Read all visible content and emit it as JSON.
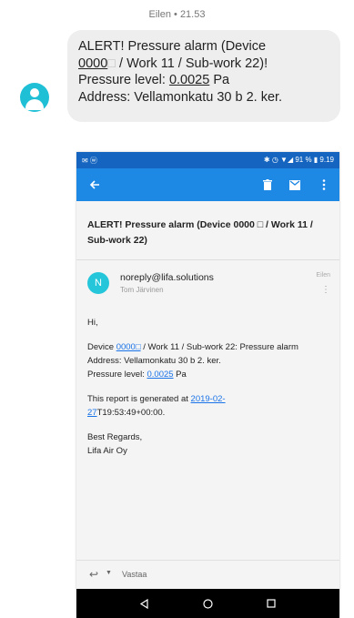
{
  "sms": {
    "meta": "Eilen • 21.53",
    "line1": "ALERT! Pressure alarm (Device",
    "device_id": "0000",
    "redacted": "□",
    "line2_rest": " / Work 11 / Sub-work 22)!",
    "pressure_prefix": "Pressure level: ",
    "pressure_value": "0.0025",
    "pressure_unit": " Pa",
    "address": "Address: Vellamonkatu 30 b 2. ker."
  },
  "phone": {
    "status_left": "✉ ⓦ",
    "status_right": "✱ ◷ ▼◢ 91 % ▮ 9.19",
    "toolbar": {
      "back_icon": "arrow-left-icon",
      "archive_icon": "archive-icon",
      "mail_icon": "mail-icon",
      "more_icon": "more-vert-icon"
    },
    "email": {
      "subject": "ALERT! Pressure alarm (Device 0000 □ / Work 11 / Sub-work 22)",
      "avatar_letter": "N",
      "from": "noreply@lifa.solutions",
      "to": "Tom Järvinen",
      "time": "Eilen",
      "greeting": "Hi,",
      "device_label": "Device ",
      "device_link": "0000□",
      "device_rest": " / Work 11 / Sub-work 22: Pressure alarm",
      "address": "Address: Vellamonkatu 30 b 2. ker.",
      "pressure_prefix": "Pressure level: ",
      "pressure_link": "0.0025",
      "pressure_unit": " Pa",
      "report_prefix": "This report is generated at ",
      "report_link_1": "2019-02-",
      "report_link_2": "27",
      "report_rest": "T19:53:49+00:00.",
      "regards": "Best Regards,",
      "company": "Lifa Air Oy"
    },
    "reply_label": "Vastaa"
  }
}
